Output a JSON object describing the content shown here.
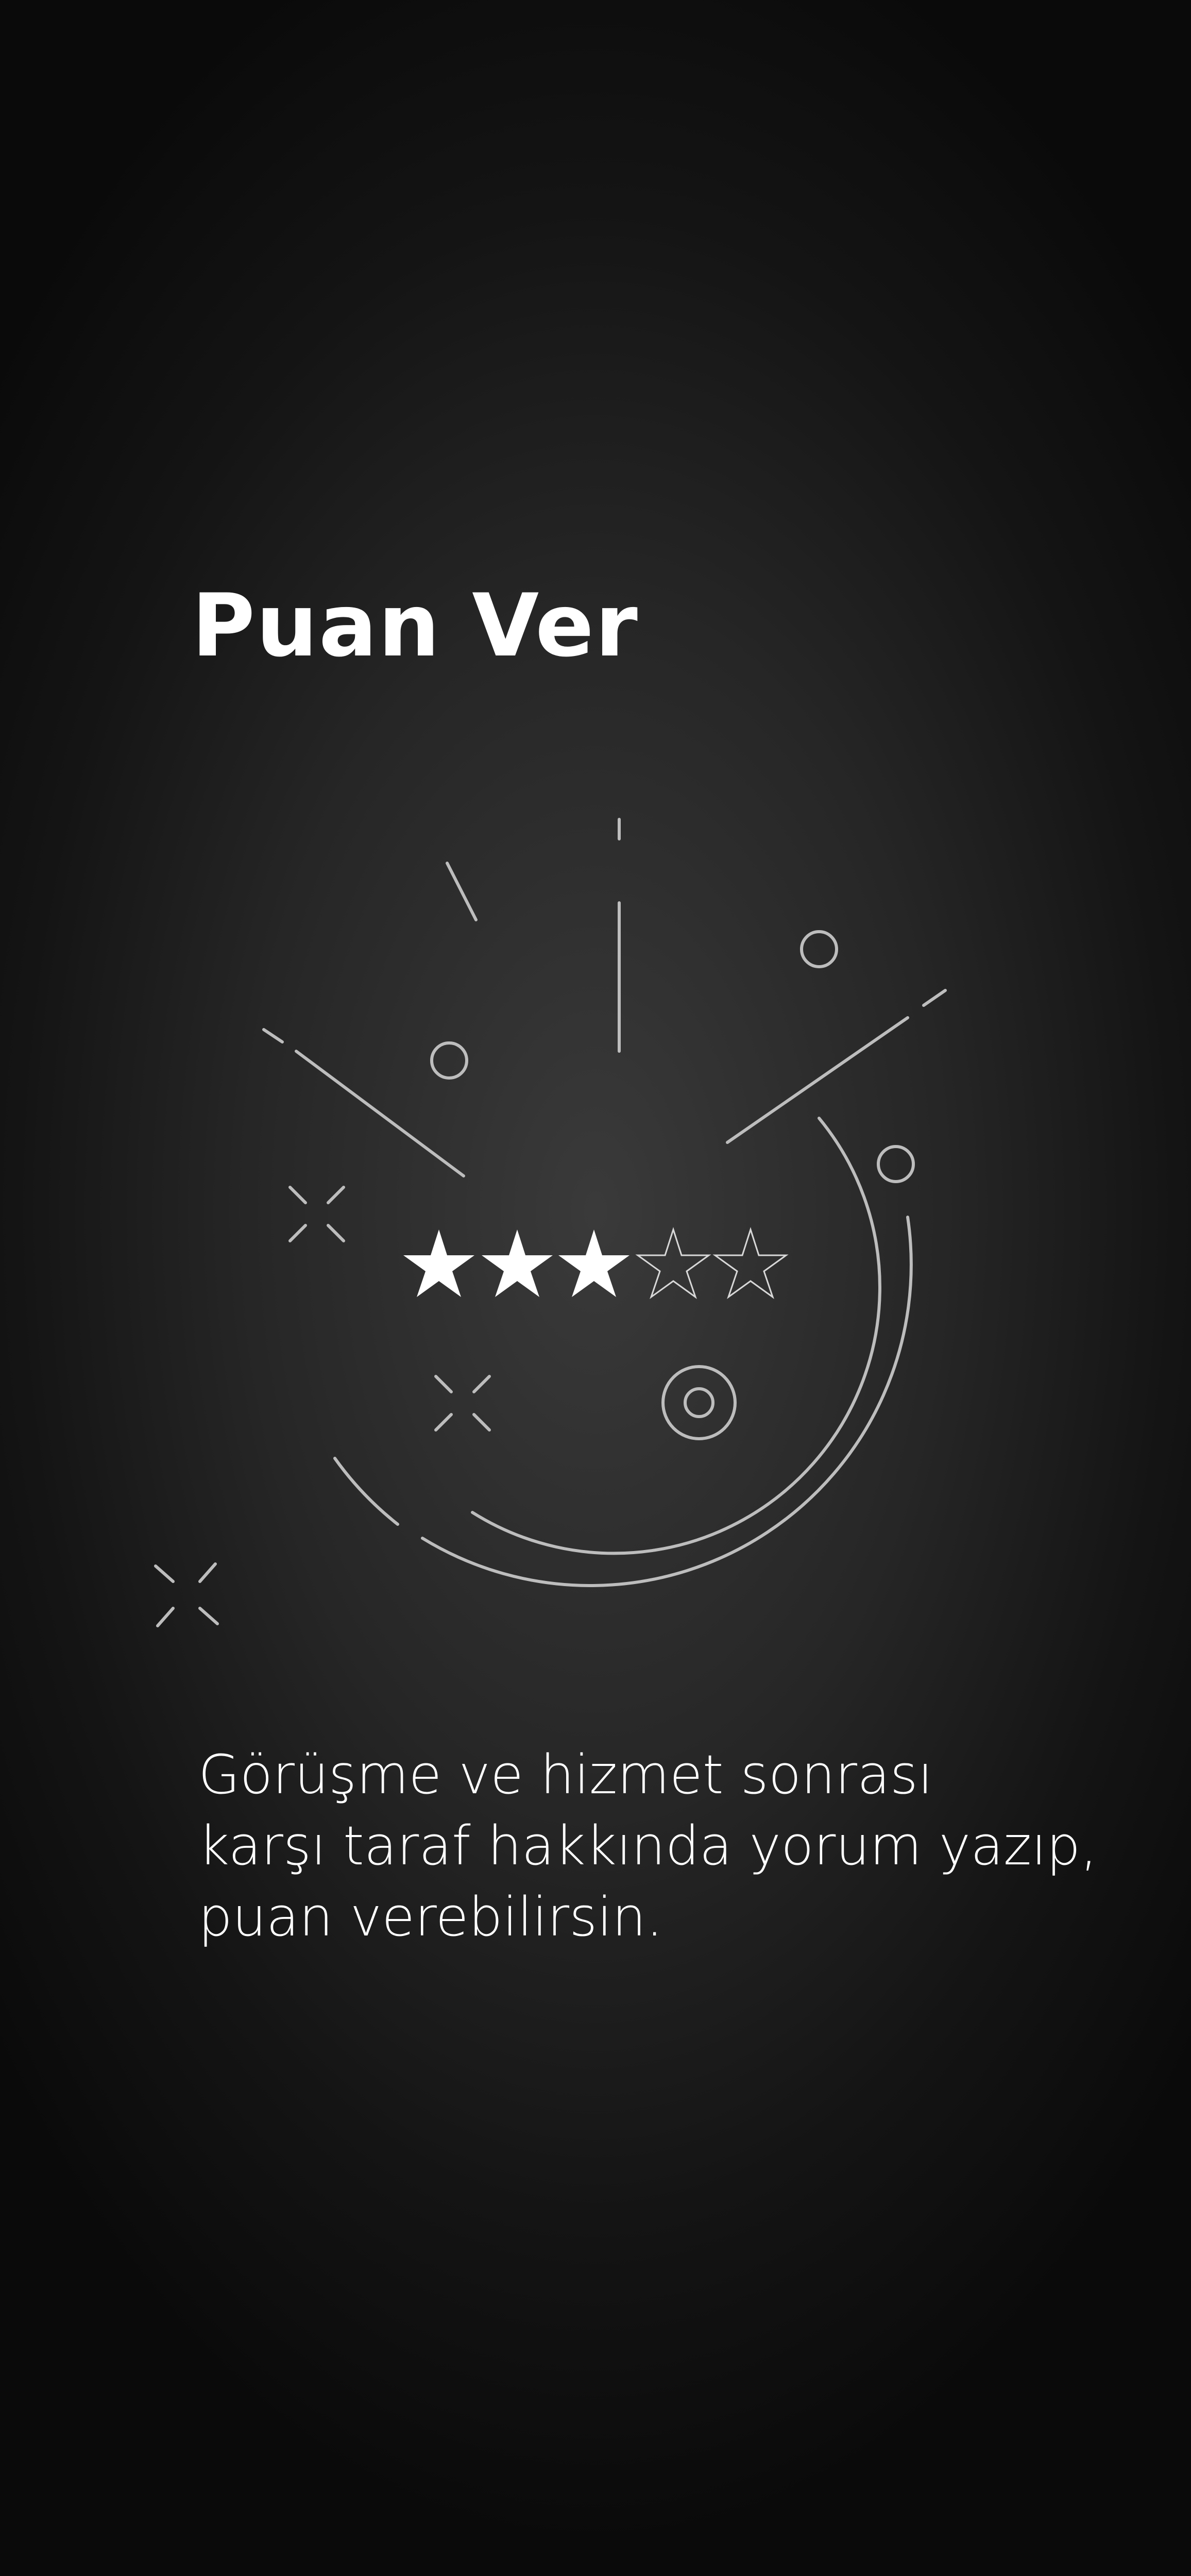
{
  "onboarding": {
    "title": "Puan Ver",
    "description_lines": [
      "Görüşme ve hizmet sonrası",
      "karşı taraf hakkında yorum yazıp,",
      "puan verebilirsin."
    ]
  },
  "rating": {
    "filled_stars": 3,
    "total_stars": 5
  },
  "icons": {
    "star_filled": "star-filled-icon",
    "star_empty": "star-outline-icon"
  },
  "colors": {
    "background_center": "#3a3a3a",
    "background_edge": "#0a0a0a",
    "text": "#ffffff",
    "illustration_line": "#bdbdbd"
  }
}
